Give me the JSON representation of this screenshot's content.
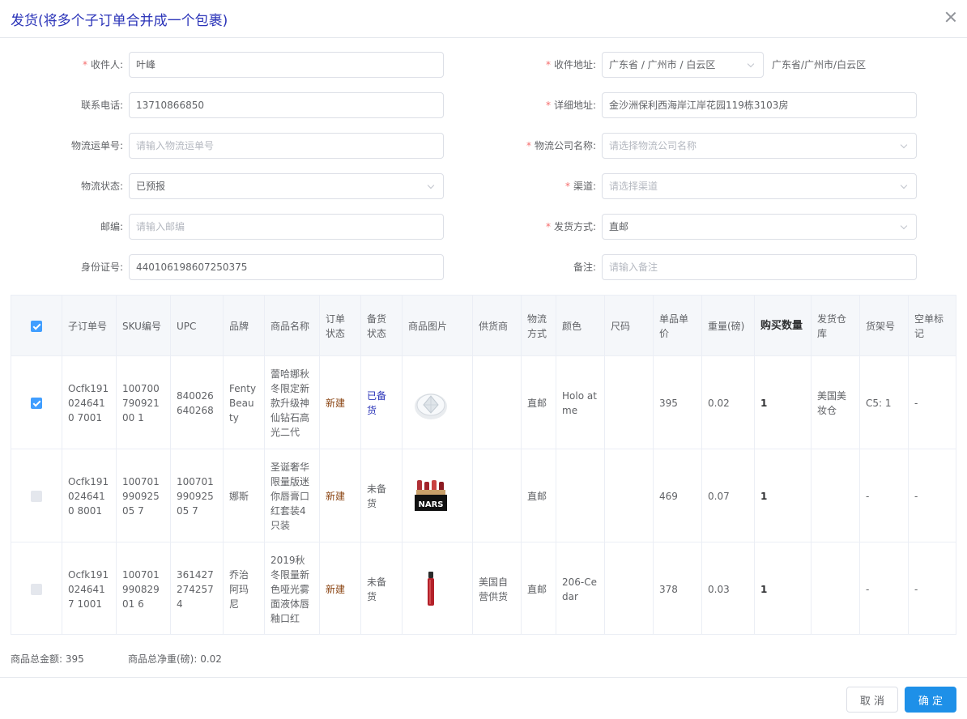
{
  "dialog": {
    "title": "发货(将多个子订单合并成一个包裹)"
  },
  "form": {
    "receiver": {
      "label": "收件人:",
      "value": "叶峰"
    },
    "address": {
      "label": "收件地址:",
      "value": "广东省 / 广州市 / 白云区",
      "text": "广东省/广州市/白云区"
    },
    "phone": {
      "label": "联系电话:",
      "value": "13710866850"
    },
    "detail_address": {
      "label": "详细地址:",
      "value": "金沙洲保利西海岸江岸花园119栋3103房"
    },
    "tracking_no": {
      "label": "物流运单号:",
      "placeholder": "请输入物流运单号"
    },
    "courier": {
      "label": "物流公司名称:",
      "placeholder": "请选择物流公司名称"
    },
    "logistics_status": {
      "label": "物流状态:",
      "value": "已预报"
    },
    "channel": {
      "label": "渠道:",
      "placeholder": "请选择渠道"
    },
    "postcode": {
      "label": "邮编:",
      "placeholder": "请输入邮编"
    },
    "ship_method": {
      "label": "发货方式:",
      "value": "直邮"
    },
    "id_number": {
      "label": "身份证号:",
      "value": "440106198607250375"
    },
    "remark": {
      "label": "备注:",
      "placeholder": "请输入备注"
    },
    "required_mark": "*"
  },
  "table": {
    "headers": [
      "子订单号",
      "SKU编号",
      "UPC",
      "品牌",
      "商品名称",
      "订单状态",
      "备货状态",
      "商品图片",
      "供货商",
      "物流方式",
      "颜色",
      "尺码",
      "单品单价",
      "重量(磅)",
      "购买数量",
      "发货仓库",
      "货架号",
      "空单标记"
    ],
    "rows": [
      {
        "order": "Ocfk1910246410 7001",
        "sku": "10070079092100 1",
        "upc": "840026640268",
        "brand": "Fenty Beauty",
        "name": "蕾哈娜秋冬限定新款升级神仙钻石高光二代",
        "status": "新建",
        "stock": "已备货",
        "supplier": "",
        "method": "直邮",
        "color": "Holo at me",
        "size": "",
        "price": "395",
        "weight": "0.02",
        "qty": "1",
        "warehouse": "美国美妆仓",
        "shelf": "C5: 1",
        "empty": "-",
        "checked": true,
        "image": "highlighter-compact"
      },
      {
        "order": "Ocfk1910246410 8001",
        "sku": "10070199092505 7",
        "upc": "10070199092505 7",
        "brand": "娜斯",
        "name": "圣诞奢华限量版迷你唇膏口红套装4只装",
        "status": "新建",
        "stock": "未备货",
        "supplier": "",
        "method": "直邮",
        "color": "",
        "size": "",
        "price": "469",
        "weight": "0.07",
        "qty": "1",
        "warehouse": "",
        "shelf": "-",
        "empty": "-",
        "checked": false,
        "image": "lipstick-set"
      },
      {
        "order": "Ocfk1910246417 1001",
        "sku": "10070199082901 6",
        "upc": "3614272742574",
        "brand": "乔治阿玛尼",
        "name": "2019秋冬限量新色哑光雾面液体唇釉口红",
        "status": "新建",
        "stock": "未备货",
        "supplier": "美国自营供货",
        "method": "直邮",
        "color": "206-Cedar",
        "size": "",
        "price": "378",
        "weight": "0.03",
        "qty": "1",
        "warehouse": "",
        "shelf": "-",
        "empty": "-",
        "checked": false,
        "image": "lip-gloss"
      }
    ]
  },
  "summary": {
    "total_amount": "商品总金额: 395",
    "total_weight": "商品总净重(磅): 0.02"
  },
  "buttons": {
    "cancel": "取 消",
    "confirm": "确 定"
  }
}
